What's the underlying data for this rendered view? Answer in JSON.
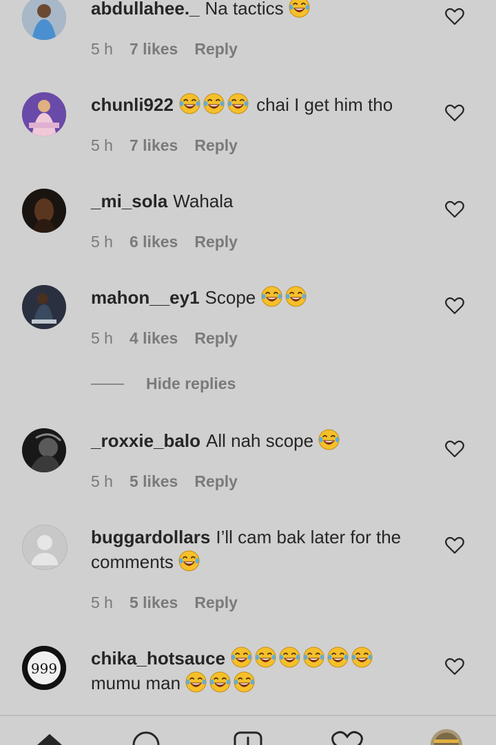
{
  "comments": [
    {
      "username": "abdullahee._",
      "text": "Na tactics",
      "emoji_count": 1,
      "time": "5 h",
      "likes": "7 likes",
      "reply": "Reply",
      "avatar": "avatar-photo-blue-outfit"
    },
    {
      "username": "chunli922",
      "text": "chai I get him tho",
      "emoji_before": 3,
      "time": "5 h",
      "likes": "7 likes",
      "reply": "Reply",
      "avatar": "avatar-photo-pink-top"
    },
    {
      "username": "_mi_sola",
      "text": "Wahala",
      "time": "5 h",
      "likes": "6 likes",
      "reply": "Reply",
      "avatar": "avatar-photo-woman-dark"
    },
    {
      "username": "mahon__ey1",
      "text": "Scope",
      "emoji_count": 2,
      "time": "5 h",
      "likes": "4 likes",
      "reply": "Reply",
      "avatar": "avatar-photo-man-seated"
    },
    {
      "username": "_roxxie_balo",
      "text": "All nah scope",
      "emoji_count": 1,
      "time": "5 h",
      "likes": "5 likes",
      "reply": "Reply",
      "avatar": "avatar-photo-bw-portrait"
    },
    {
      "username": "buggardollars",
      "text": "I’ll cam bak later for the comments",
      "emoji_count": 1,
      "time": "5 h",
      "likes": "5 likes",
      "reply": "Reply",
      "avatar": "default-avatar-icon"
    },
    {
      "username": "chika_hotsauce",
      "text": "mumu man",
      "emoji_before": 6,
      "emoji_count": 3,
      "avatar": "avatar-logo-bw"
    }
  ],
  "hide_replies": "Hide replies",
  "nav": [
    "home-icon",
    "search-icon",
    "new-post-icon",
    "activity-heart-icon",
    "profile-avatar"
  ],
  "colors": {
    "background": "#d0d0d0",
    "meta": "#7a7a7a",
    "text": "#262626",
    "emoji_face": "#f5c02a"
  }
}
